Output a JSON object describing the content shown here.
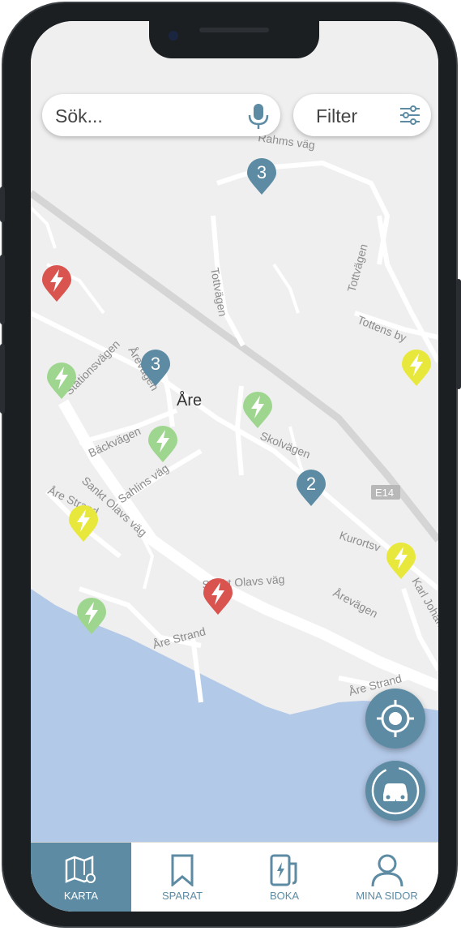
{
  "search": {
    "placeholder": "Sök..."
  },
  "filter": {
    "label": "Filter"
  },
  "map": {
    "labels": {
      "are": "Åre",
      "stationsvagen": "Stationsvägen",
      "arevagen_small": "Årevägen",
      "backvagen": "Bäckvägen",
      "sahlins_vag": "Sahlins väg",
      "sankt_olavs_vag_1": "Sankt Olavs väg",
      "sankt_olavs_vag_2": "Sankt Olavs väg",
      "are_strand_1": "Åre Strand",
      "are_strand_2": "Åre Strand",
      "are_strand_3": "Åre Strand",
      "arevagen": "Årevägen",
      "skolvagen": "Skolvägen",
      "tottvagen_1": "Tottvägen",
      "tottvagen_2": "Tottvägen",
      "tottens_by": "Tottens by",
      "kurortsv": "Kurortsv",
      "karl_johans": "Karl Johans v",
      "rahms_vag": "Rahms väg",
      "e14": "E14"
    },
    "clusters": [
      {
        "count": "3"
      },
      {
        "count": "3"
      },
      {
        "count": "2"
      }
    ]
  },
  "colors": {
    "accent": "#5c8ba3",
    "pin_red": "#d9534f",
    "pin_green": "#9fd68f",
    "pin_yellow": "#e8e83c",
    "water": "#b3c9e8"
  },
  "tabs": [
    {
      "label": "KARTA",
      "icon": "map-icon",
      "active": true
    },
    {
      "label": "SPARAT",
      "icon": "bookmark-icon",
      "active": false
    },
    {
      "label": "BOKA",
      "icon": "charger-icon",
      "active": false
    },
    {
      "label": "MINA SIDOR",
      "icon": "user-icon",
      "active": false
    }
  ]
}
